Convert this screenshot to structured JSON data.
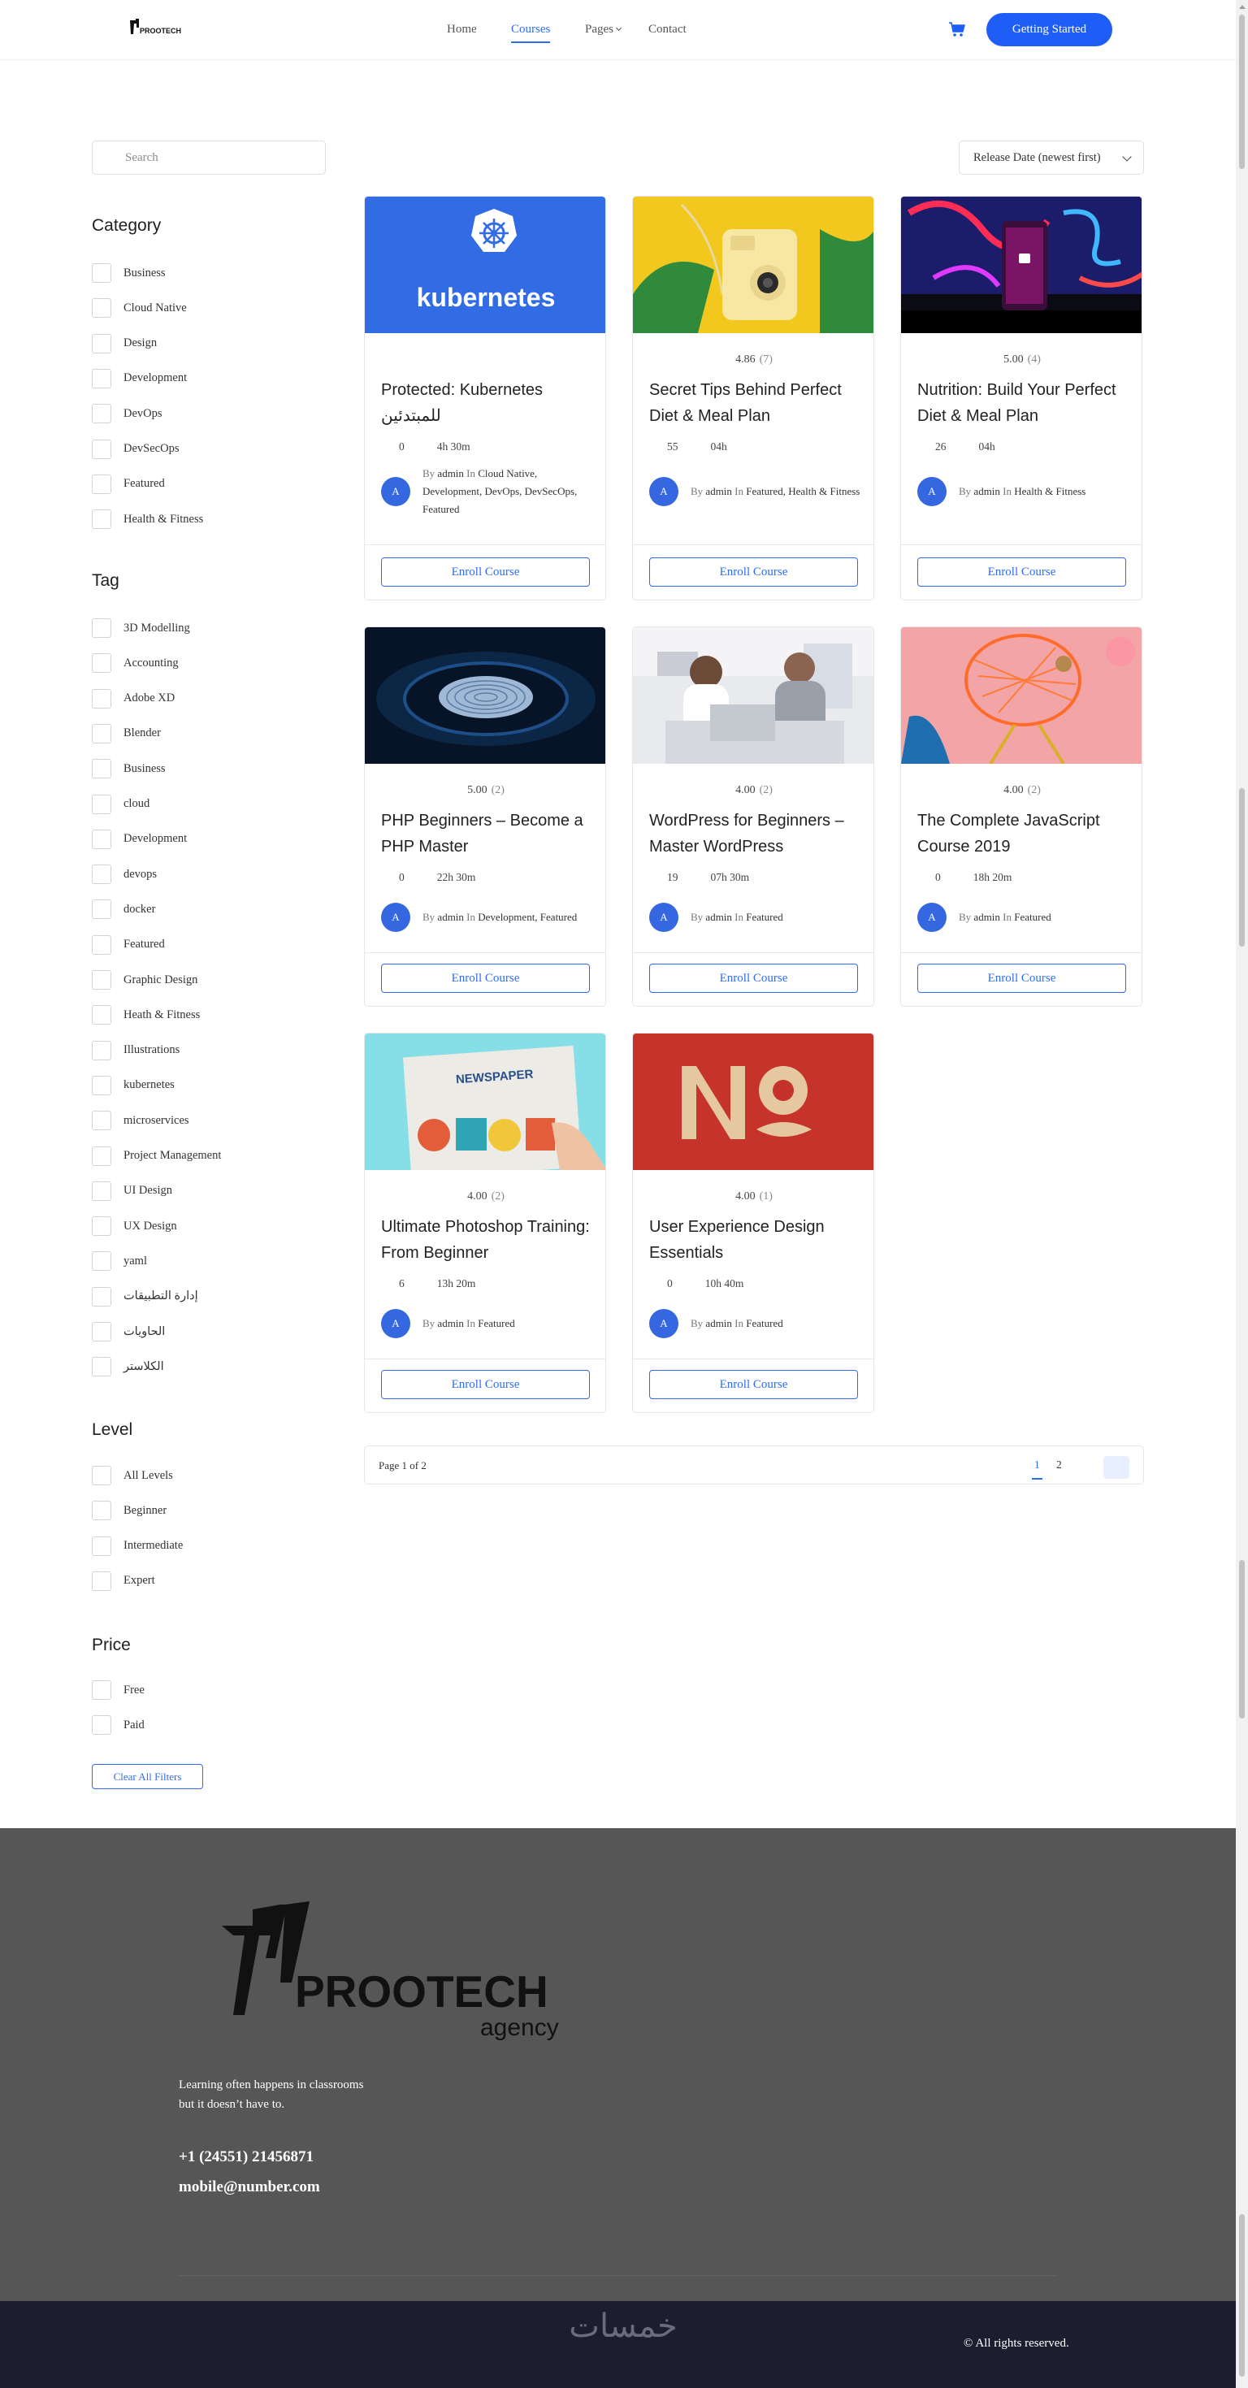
{
  "header": {
    "logo_text": "PROOTECH",
    "nav": [
      {
        "label": "Home"
      },
      {
        "label": "Courses",
        "active": true
      },
      {
        "label": "Pages"
      },
      {
        "label": "Contact"
      }
    ],
    "cta_label": "Getting Started",
    "accent_color": "#1f5ef6"
  },
  "filters": {
    "search_placeholder": "Search",
    "sort_selected": "Release Date (newest first)",
    "category": {
      "title": "Category",
      "items": [
        "Business",
        "Cloud Native",
        "Design",
        "Development",
        "DevOps",
        "DevSecOps",
        "Featured",
        "Health & Fitness"
      ]
    },
    "tag": {
      "title": "Tag",
      "items": [
        "3D Modelling",
        "Accounting",
        "Adobe XD",
        "Blender",
        "Business",
        "cloud",
        "Development",
        "devops",
        "docker",
        "Featured",
        "Graphic Design",
        "Heath & Fitness",
        "Illustrations",
        "kubernetes",
        "microservices",
        "Project Management",
        "UI Design",
        "UX Design",
        "yaml",
        "إدارة التطبيقات",
        "الحاويات",
        "الكلاستر"
      ]
    },
    "level": {
      "title": "Level",
      "items": [
        "All Levels",
        "Beginner",
        "Intermediate",
        "Expert"
      ]
    },
    "price": {
      "title": "Price",
      "items": [
        "Free",
        "Paid"
      ]
    },
    "clear_label": "Clear All Filters"
  },
  "courses": [
    {
      "title": "Protected: Kubernetes للمبتدئين",
      "rating": "",
      "rating_count": "",
      "students": "0",
      "duration": "4h 30m",
      "by": "By",
      "author": "admin",
      "in": "In",
      "categories": "Cloud Native, Development, DevOps, DevSecOps, Featured",
      "thumb_text": "kubernetes",
      "enroll": "Enroll Course"
    },
    {
      "title": "Secret Tips Behind Perfect Diet & Meal Plan",
      "rating": "4.86",
      "rating_count": "(7)",
      "students": "55",
      "duration": "04h",
      "by": "By",
      "author": "admin",
      "in": "In",
      "categories": "Featured, Health & Fitness",
      "enroll": "Enroll Course"
    },
    {
      "title": "Nutrition: Build Your Perfect Diet & Meal Plan",
      "rating": "5.00",
      "rating_count": "(4)",
      "students": "26",
      "duration": "04h",
      "by": "By",
      "author": "admin",
      "in": "In",
      "categories": "Health & Fitness",
      "enroll": "Enroll Course"
    },
    {
      "title": "PHP Beginners – Become a PHP Master",
      "rating": "5.00",
      "rating_count": "(2)",
      "students": "0",
      "duration": "22h 30m",
      "by": "By",
      "author": "admin",
      "in": "In",
      "categories": "Development, Featured",
      "enroll": "Enroll Course"
    },
    {
      "title": "WordPress for Beginners – Master WordPress",
      "rating": "4.00",
      "rating_count": "(2)",
      "students": "19",
      "duration": "07h 30m",
      "by": "By",
      "author": "admin",
      "in": "In",
      "categories": "Featured",
      "enroll": "Enroll Course"
    },
    {
      "title": "The Complete JavaScript Course 2019",
      "rating": "4.00",
      "rating_count": "(2)",
      "students": "0",
      "duration": "18h 20m",
      "by": "By",
      "author": "admin",
      "in": "In",
      "categories": "Featured",
      "enroll": "Enroll Course"
    },
    {
      "title": "Ultimate Photoshop Training: From Beginner",
      "rating": "4.00",
      "rating_count": "(2)",
      "students": "6",
      "duration": "13h 20m",
      "by": "By",
      "author": "admin",
      "in": "In",
      "categories": "Featured",
      "thumb_text": "NEWSPAPER",
      "enroll": "Enroll Course"
    },
    {
      "title": "User Experience Design Essentials",
      "rating": "4.00",
      "rating_count": "(1)",
      "students": "0",
      "duration": "10h 40m",
      "by": "By",
      "author": "admin",
      "in": "In",
      "categories": "Featured",
      "enroll": "Enroll Course"
    }
  ],
  "avatar_initial": "A",
  "pagination": {
    "info": "Page 1 of 2",
    "pages": [
      "1",
      "2"
    ],
    "current": "1"
  },
  "footer": {
    "logo_text": "PROOTECH",
    "logo_subtext": "agency",
    "tagline_line1": "Learning often happens in classrooms",
    "tagline_line2": "but it doesn’t have to.",
    "phone": "+1 (24551) 21456871",
    "email": "mobile@number.com",
    "watermark": "خمسات",
    "copyright": "© All rights reserved."
  }
}
